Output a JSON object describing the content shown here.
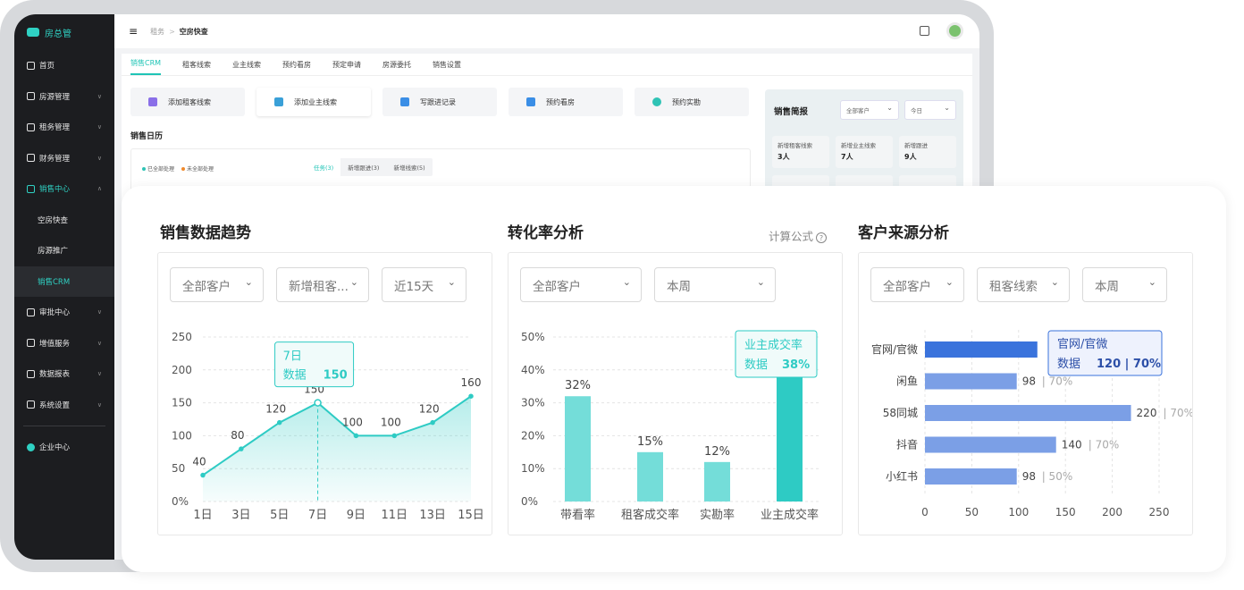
{
  "app": {
    "brand": "房总管",
    "breadcrumb": [
      "租务",
      "空房快查"
    ]
  },
  "sidebar": {
    "items": [
      {
        "label": "首页",
        "has_chevron": false
      },
      {
        "label": "房源管理",
        "has_chevron": true
      },
      {
        "label": "租务管理",
        "has_chevron": true
      },
      {
        "label": "财务管理",
        "has_chevron": true
      },
      {
        "label": "销售中心",
        "has_chevron": true,
        "open": true
      }
    ],
    "sub_items": [
      "空房快查",
      "房源推广",
      "销售CRM"
    ],
    "items_after": [
      "审批中心",
      "增值服务",
      "数据报表",
      "系统设置"
    ],
    "enterprise": "企业中心"
  },
  "tabs": [
    "销售CRM",
    "租客线索",
    "业主线索",
    "预约看房",
    "预定申请",
    "房源委托",
    "销售设置"
  ],
  "actions": [
    "添加租客线索",
    "添加业主线索",
    "写跟进记录",
    "预约看房",
    "预约实勘"
  ],
  "calendar": {
    "title": "销售日历",
    "legend": [
      "已全部处理",
      "未全部处理"
    ],
    "tabs": [
      "任务(3)",
      "新增跟进(3)",
      "新增线索(5)"
    ]
  },
  "brief": {
    "title": "销售简报",
    "selects": [
      "全部客户",
      "今日"
    ],
    "stats": [
      {
        "label": "新增租客线索",
        "value": "3人"
      },
      {
        "label": "新增业主线索",
        "value": "7人"
      },
      {
        "label": "新增跟进",
        "value": "9人"
      }
    ]
  },
  "trend": {
    "title": "销售数据趋势",
    "selects": [
      "全部客户",
      "新增租客...",
      "近15天"
    ],
    "tooltip": {
      "line1": "7日",
      "label": "数据",
      "value": "150"
    }
  },
  "conversion": {
    "title": "转化率分析",
    "formula": "计算公式",
    "selects": [
      "全部客户",
      "本周"
    ],
    "tooltip": {
      "line1": "业主成交率",
      "label": "数据",
      "value": "38%"
    }
  },
  "source": {
    "title": "客户来源分析",
    "selects": [
      "全部客户",
      "租客线索",
      "本周"
    ],
    "tooltip": {
      "line1": "官网/官微",
      "label": "数据",
      "value": "120",
      "pct": "70%"
    }
  },
  "colors": {
    "accent": "#2ecbc4",
    "accent_light": "#74ddd9",
    "bar_blue": "#7b9fe6",
    "bar_blue_dark": "#3a73dc"
  },
  "chart_data": [
    {
      "type": "area",
      "title": "销售数据趋势",
      "x": [
        "1日",
        "3日",
        "5日",
        "7日",
        "9日",
        "11日",
        "13日",
        "15日"
      ],
      "values": [
        40,
        80,
        120,
        150,
        100,
        100,
        120,
        160
      ],
      "y_ticks": [
        "0%",
        "50",
        "100",
        "150",
        "200",
        "250"
      ],
      "ylim": [
        0,
        250
      ]
    },
    {
      "type": "bar",
      "title": "转化率分析",
      "categories": [
        "带看率",
        "租客成交率",
        "实勘率",
        "业主成交率"
      ],
      "values": [
        32,
        15,
        12,
        38
      ],
      "labels": [
        "32%",
        "15%",
        "12%",
        ""
      ],
      "y_ticks": [
        "0%",
        "10%",
        "20%",
        "30%",
        "40%",
        "50%"
      ],
      "ylim": [
        0,
        50
      ]
    },
    {
      "type": "bar",
      "orientation": "horizontal",
      "title": "客户来源分析",
      "categories": [
        "官网/官微",
        "闲鱼",
        "58同城",
        "抖音",
        "小红书"
      ],
      "values": [
        120,
        98,
        220,
        140,
        98
      ],
      "percents": [
        "70%",
        "70%",
        "70%",
        "70%",
        "50%"
      ],
      "x_ticks": [
        "0",
        "50",
        "100",
        "150",
        "200",
        "250"
      ],
      "xlim": [
        0,
        250
      ]
    }
  ]
}
